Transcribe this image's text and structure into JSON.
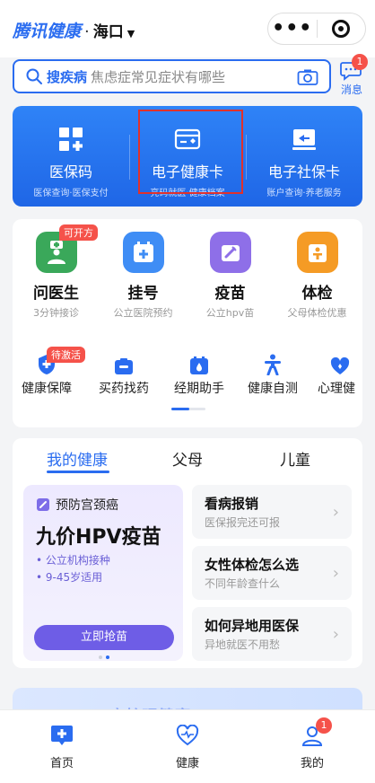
{
  "header": {
    "brand": "腾讯健康",
    "separator": "·",
    "city": "海口",
    "more_glyph": "•••"
  },
  "search": {
    "keyword": "搜疾病",
    "hint": "焦虑症常见症状有哪些",
    "message_label": "消息",
    "message_badge": "1"
  },
  "cards": [
    {
      "title": "医保码",
      "subtitle": "医保查询·医保支付",
      "icon": "qr-grid-icon"
    },
    {
      "title": "电子健康卡",
      "subtitle": "亮码就医·健康档案",
      "icon": "health-card-icon"
    },
    {
      "title": "电子社保卡",
      "subtitle": "账户查询·养老服务",
      "icon": "social-card-icon"
    }
  ],
  "services": [
    {
      "title": "问医生",
      "subtitle": "3分钟接诊",
      "tag": "可开方",
      "color": "#3aa85a",
      "icon": "doctor-icon"
    },
    {
      "title": "挂号",
      "subtitle": "公立医院预约",
      "tag": "",
      "color": "#3f8df5",
      "icon": "calendar-plus-icon"
    },
    {
      "title": "疫苗",
      "subtitle": "公立hpv苗",
      "tag": "",
      "color": "#8e6fe8",
      "icon": "syringe-icon"
    },
    {
      "title": "体检",
      "subtitle": "父母体检优惠",
      "tag": "",
      "color": "#f59b25",
      "icon": "checkup-icon"
    }
  ],
  "mini_services": [
    {
      "label": "健康保障",
      "tag": "待激活",
      "icon": "shield-icon"
    },
    {
      "label": "买药找药",
      "tag": "",
      "icon": "medicine-box-icon"
    },
    {
      "label": "经期助手",
      "tag": "",
      "icon": "period-calendar-icon"
    },
    {
      "label": "健康自测",
      "tag": "",
      "icon": "person-icon"
    },
    {
      "label": "心理健",
      "tag": "",
      "icon": "heart-icon"
    }
  ],
  "health": {
    "tabs": [
      "我的健康",
      "父母",
      "儿童"
    ],
    "active_tab": 0,
    "hpv": {
      "header": "预防宫颈癌",
      "title": "九价HPV疫苗",
      "items": [
        "• 公立机构接种",
        "• 9-45岁适用"
      ],
      "button": "立即抢苗"
    },
    "cards": [
      {
        "title": "看病报销",
        "subtitle": "医保报完还可报"
      },
      {
        "title": "女性体检怎么选",
        "subtitle": "不同年龄查什么"
      },
      {
        "title": "如何异地用医保",
        "subtitle": "异地就医不用愁"
      }
    ]
  },
  "peek": {
    "text": "守护眼健康"
  },
  "tabbar": [
    {
      "label": "首页",
      "icon": "home-icon",
      "badge": ""
    },
    {
      "label": "健康",
      "icon": "heart-icon",
      "badge": ""
    },
    {
      "label": "我的",
      "icon": "user-icon",
      "badge": "1"
    }
  ],
  "colors": {
    "primary": "#2a6cf0",
    "badge": "#f5524a",
    "highlight": "#e0312c"
  }
}
